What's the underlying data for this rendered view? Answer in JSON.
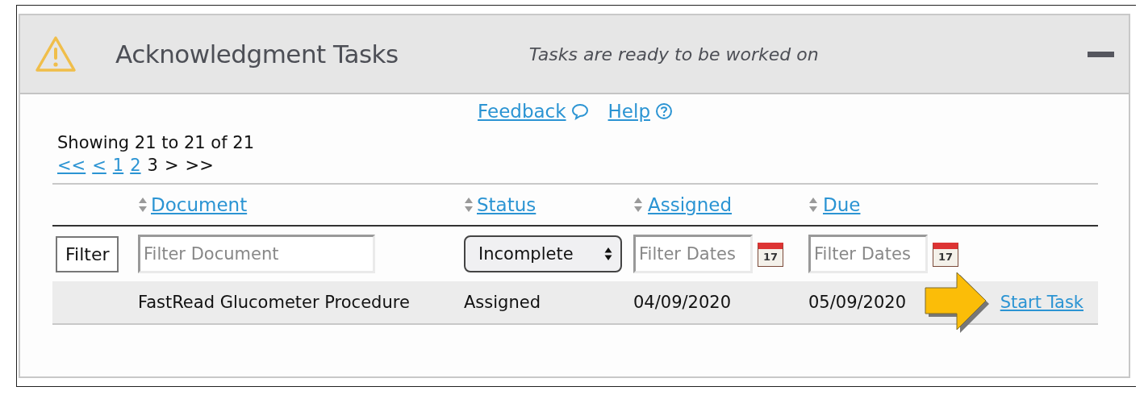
{
  "panel": {
    "title": "Acknowledgment Tasks",
    "subtitle": "Tasks are ready to be worked on"
  },
  "links": [
    {
      "label": "Feedback",
      "kind": "feedback"
    },
    {
      "label": "Help",
      "kind": "help"
    }
  ],
  "summary": "Showing 21 to 21 of 21",
  "pagination": [
    {
      "label": "<<",
      "kind": "link"
    },
    {
      "label": "<",
      "kind": "link"
    },
    {
      "label": "1",
      "kind": "link"
    },
    {
      "label": "2",
      "kind": "link"
    },
    {
      "label": "3",
      "kind": "current"
    },
    {
      "label": ">",
      "kind": "plain"
    },
    {
      "label": ">>",
      "kind": "plain"
    }
  ],
  "table": {
    "columns": [
      {
        "label": "Document"
      },
      {
        "label": "Status"
      },
      {
        "label": "Assigned"
      },
      {
        "label": "Due"
      }
    ],
    "filters": {
      "button": "Filter",
      "document_placeholder": "Filter Document",
      "status_value": "Incomplete",
      "assigned_placeholder": "Filter Dates",
      "assigned_calendar_day": "17",
      "due_placeholder": "Filter Dates",
      "due_calendar_day": "17"
    },
    "rows": [
      {
        "document": "FastRead Glucometer Procedure",
        "status": "Assigned",
        "assigned": "04/09/2020",
        "due": "05/09/2020",
        "action": "Start Task"
      }
    ]
  }
}
